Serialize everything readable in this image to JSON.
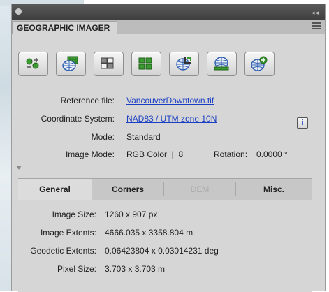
{
  "panel": {
    "tab_label": "GEOGRAPHIC IMAGER"
  },
  "toolbar": {
    "buttons": [
      {
        "icon": "transform-points-icon"
      },
      {
        "icon": "georeference-globe-icon"
      },
      {
        "icon": "mosaic-tiles-icon"
      },
      {
        "icon": "tile-grid-icon"
      },
      {
        "icon": "globe-crop-icon"
      },
      {
        "icon": "globe-stack-icon"
      },
      {
        "icon": "globe-add-icon"
      }
    ],
    "colors": {
      "green": "#3c9a33",
      "blue": "#2f5fb0"
    }
  },
  "info": {
    "reference_file_label": "Reference file:",
    "reference_file_value": "VancouverDowntown.tif",
    "coordinate_system_label": "Coordinate System:",
    "coordinate_system_value": "NAD83 / UTM zone 10N",
    "info_button": "i",
    "mode_label": "Mode:",
    "mode_value": "Standard",
    "image_mode_label": "Image Mode:",
    "image_mode_value": "RGB Color  |  8",
    "rotation_label": "Rotation:",
    "rotation_value": "0.0000 °"
  },
  "tabs": [
    {
      "label": "General",
      "state": "selected"
    },
    {
      "label": "Corners",
      "state": "normal"
    },
    {
      "label": "DEM",
      "state": "disabled"
    },
    {
      "label": "Misc.",
      "state": "normal"
    }
  ],
  "general": {
    "image_size_label": "Image Size:",
    "image_size_value": "1260 x 907 px",
    "image_extents_label": "Image Extents:",
    "image_extents_value": "4666.035 x 3358.804 m",
    "geodetic_extents_label": "Geodetic Extents:",
    "geodetic_extents_value": "0.06423804 x 0.03014231 deg",
    "pixel_size_label": "Pixel Size:",
    "pixel_size_value": "3.703 x 3.703 m"
  }
}
